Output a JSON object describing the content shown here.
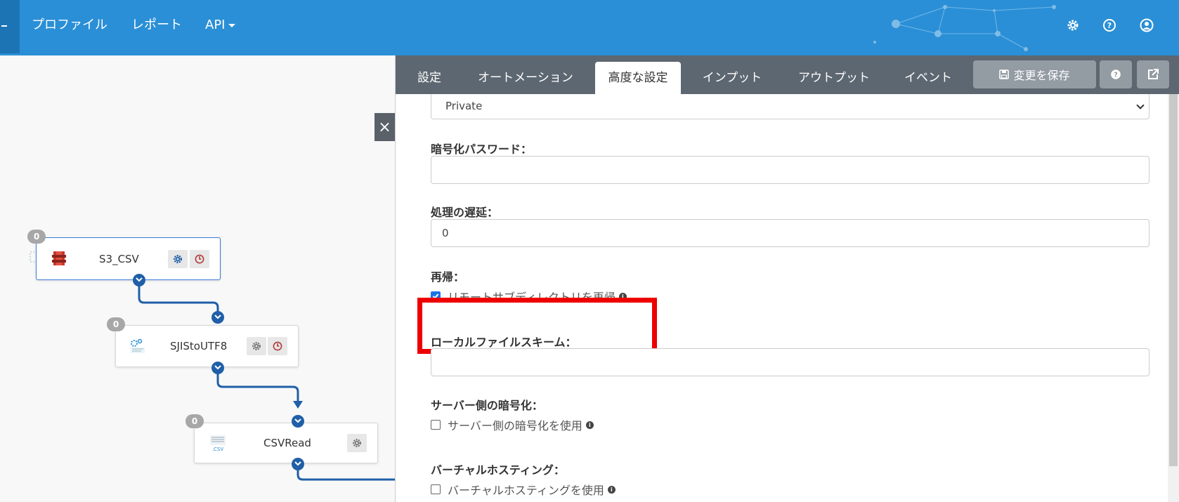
{
  "topnav": {
    "items": [
      "プロファイル",
      "レポート",
      "API"
    ],
    "icons": [
      "gear-icon",
      "help-icon",
      "user-icon"
    ]
  },
  "canvas": {
    "nodes": [
      {
        "label": "S3_CSV",
        "count": "0",
        "icon": "aws-s3-icon"
      },
      {
        "label": "SJIStoUTF8",
        "count": "0",
        "icon": "encoding-icon"
      },
      {
        "label": "CSVRead",
        "count": "0",
        "icon": "csv-file-icon",
        "icon_text": ".CSV"
      }
    ],
    "close_label": "×"
  },
  "panel": {
    "tabs": [
      "設定",
      "オートメーション",
      "高度な設定",
      "インプット",
      "アウトプット",
      "イベント"
    ],
    "active_tab": "高度な設定",
    "save_label": "変更を保存",
    "select_value": "Private",
    "fields": {
      "encryption_password_label": "暗号化パスワード：",
      "encryption_password_value": "",
      "delay_label": "処理の遅延：",
      "delay_value": "0",
      "recursive_label": "再帰：",
      "recursive_checkbox_label": "リモートサブディレクトリを再帰",
      "recursive_checked": true,
      "local_scheme_label": "ローカルファイルスキーム：",
      "local_scheme_value": "",
      "sse_label": "サーバー側の暗号化：",
      "sse_checkbox_label": "サーバー側の暗号化を使用",
      "sse_checked": false,
      "virtual_hosting_label": "バーチャルホスティング：",
      "virtual_hosting_checkbox_label": "バーチャルホスティングを使用",
      "virtual_hosting_checked": false
    }
  },
  "colors": {
    "nav_bg": "#2a8fd6",
    "tabbar_bg": "#5d6771",
    "highlight": "#ee0000",
    "port": "#1f5fa8",
    "checkbox_checked": "#1a73e8"
  }
}
